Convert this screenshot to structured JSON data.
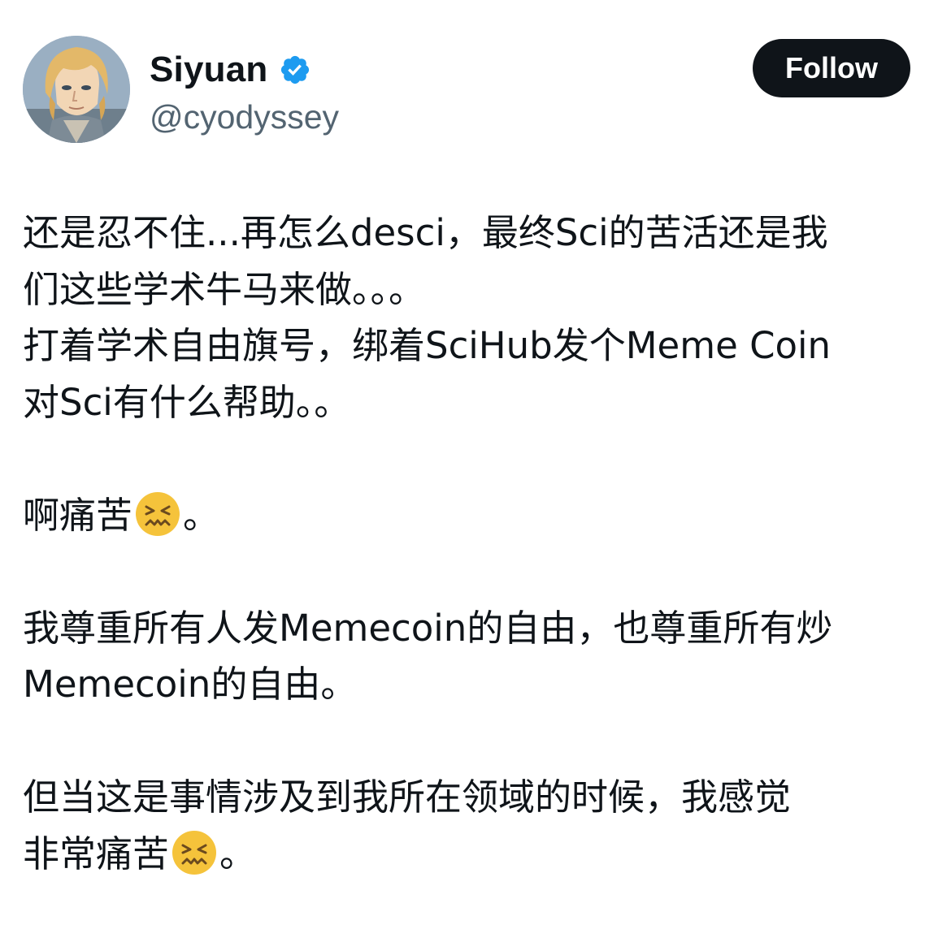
{
  "user": {
    "display_name": "Siyuan",
    "handle": "@cyodyssey",
    "verified_icon": "verified-badge-icon",
    "avatar": "anime-portrait-avatar"
  },
  "actions": {
    "follow_label": "Follow"
  },
  "colors": {
    "verified_blue": "#1d9bf0",
    "follow_bg": "#0f1419",
    "handle_gray": "#536471",
    "text": "#0f1419"
  },
  "tweet": {
    "lines": [
      "还是忍不住...再怎么desci，最终Sci的苦活还是我",
      "们这些学术牛马来做。。。",
      "打着学术自由旗号，绑着SciHub发个Meme Coin",
      "对Sci有什么帮助。。",
      "啊痛苦",
      "。",
      "我尊重所有人发Memecoin的自由，也尊重所有炒",
      "Memecoin的自由。",
      "但当这是事情涉及到我所在领域的时候，我感觉",
      "非常痛苦",
      "。"
    ],
    "emoji": "confounded-face-emoji"
  }
}
